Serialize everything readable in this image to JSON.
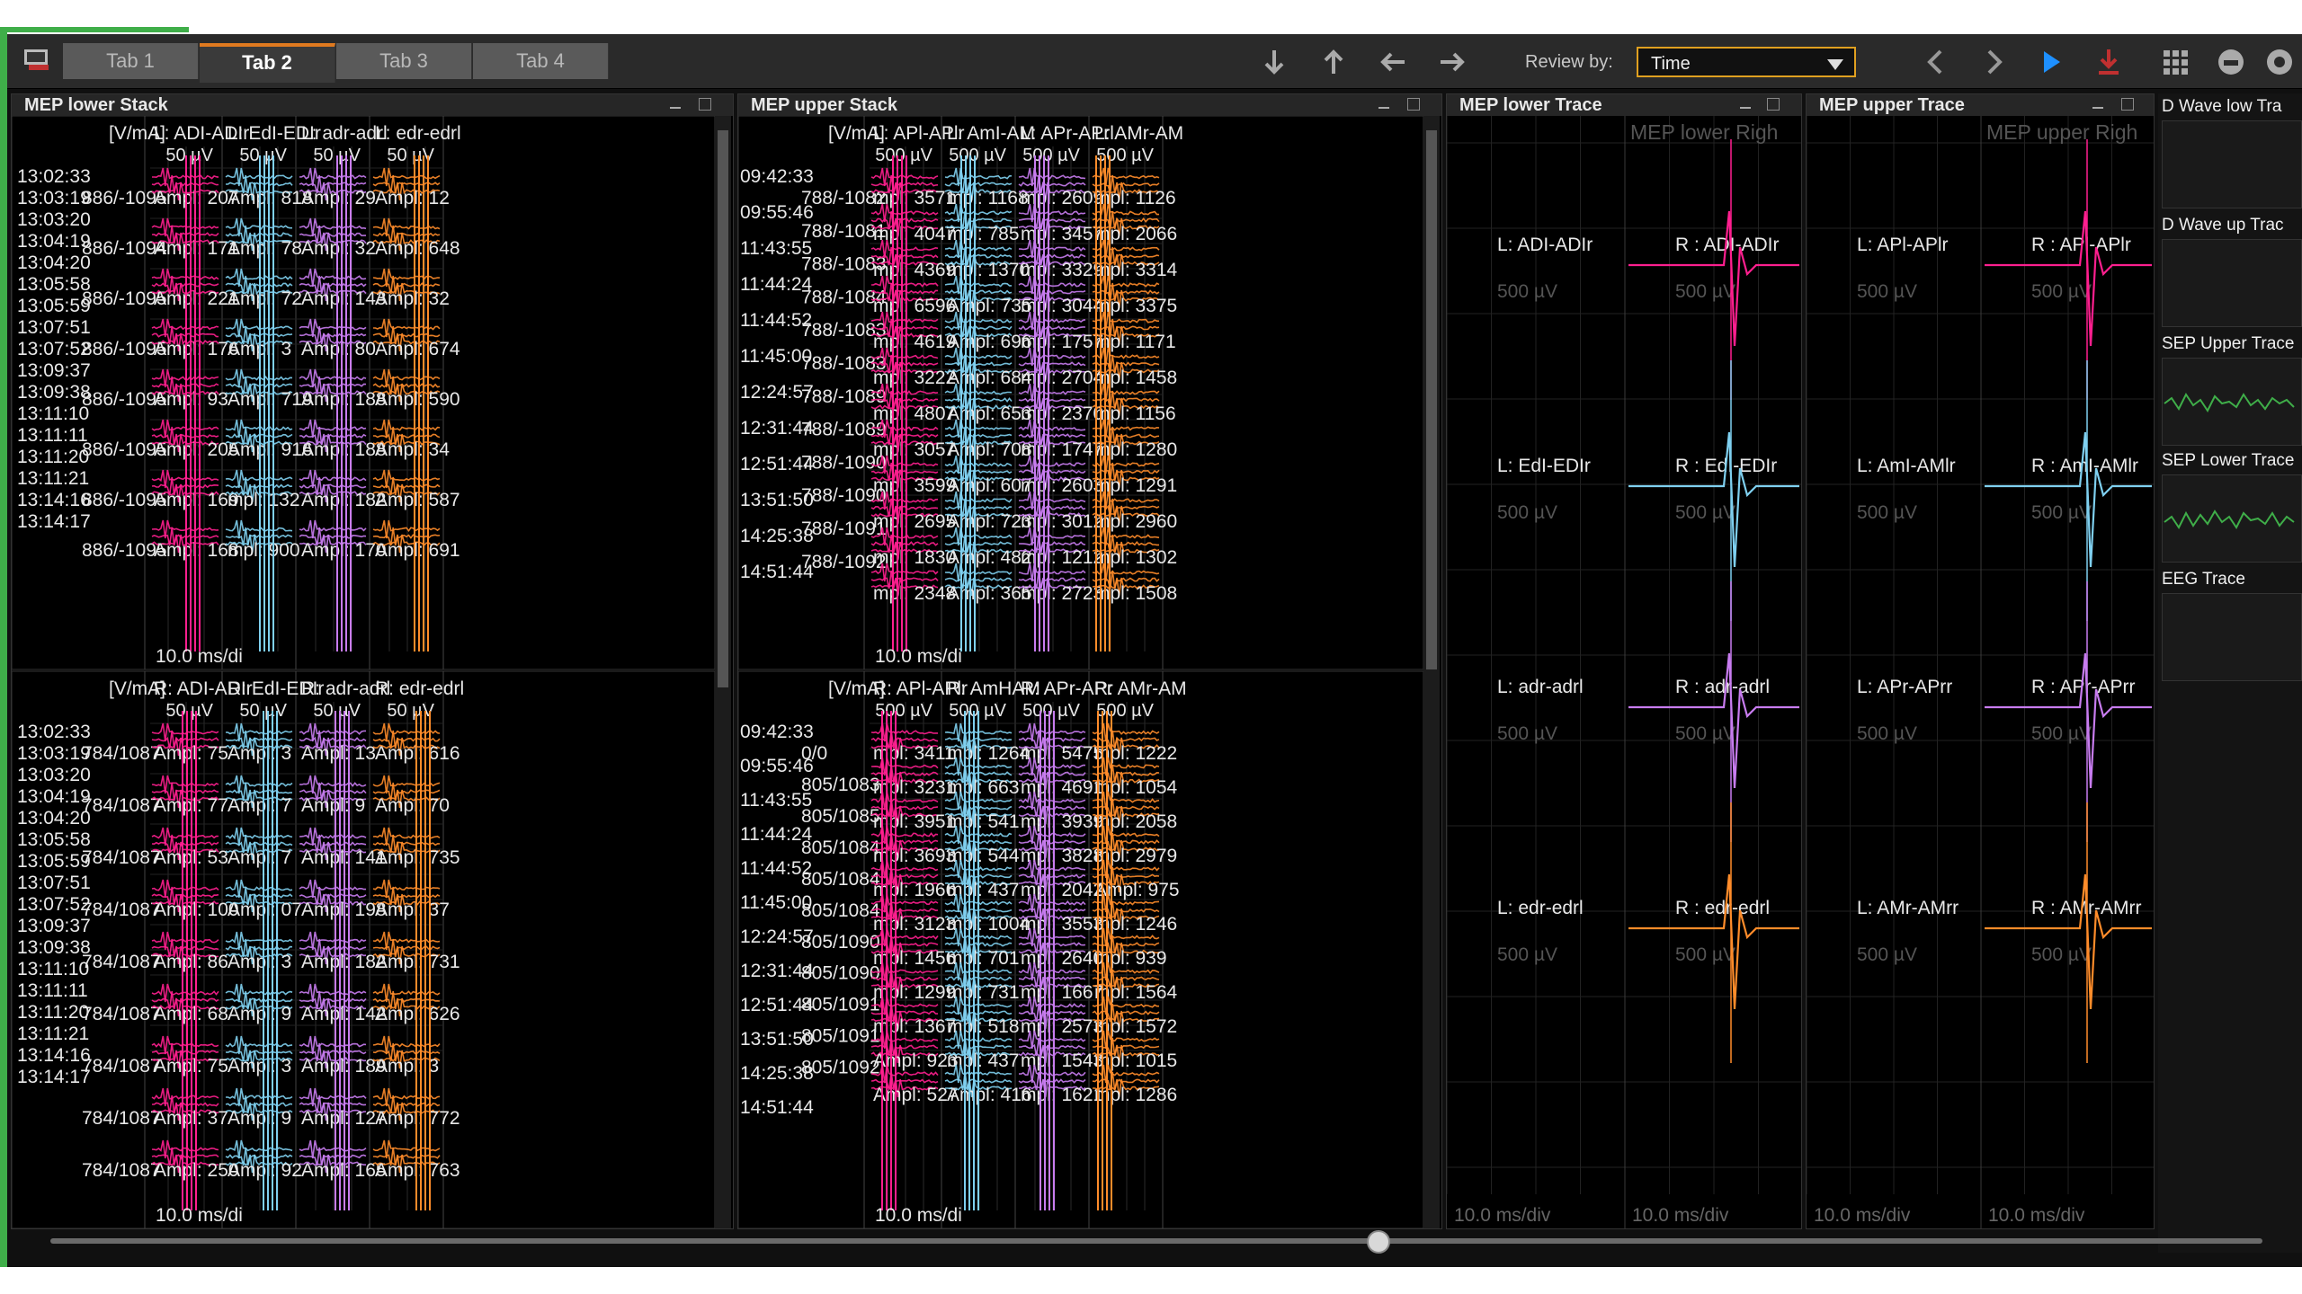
{
  "toolbar": {
    "tabs": [
      "Tab 1",
      "Tab 2",
      "Tab 3",
      "Tab 4"
    ],
    "active_tab": "Tab 2",
    "review_label": "Review by:",
    "review_value": "Time"
  },
  "panels": {
    "lower_stack_title": "MEP lower Stack",
    "upper_stack_title": "MEP upper Stack",
    "lower_trace_title": "MEP lower Trace",
    "upper_trace_title": "MEP upper Trace"
  },
  "lower_stack": {
    "top": {
      "unit": "[V/mA]",
      "channels": [
        "L: ADI-ADIr",
        "L: EdI-EDIr",
        "L: adr-adrl",
        "L: edr-edrl"
      ],
      "scales": [
        "50 µV",
        "50 µV",
        "50 µV",
        "50 µV"
      ],
      "times": [
        "13:02:33",
        "13:03:19",
        "13:03:20",
        "13:04:19",
        "13:04:20",
        "13:05:58",
        "13:05:59",
        "13:07:51",
        "13:07:52",
        "13:09:37",
        "13:09:38",
        "13:11:10",
        "13:11:11",
        "13:11:20",
        "13:11:21",
        "13:14:16",
        "13:14:17"
      ],
      "stims": [
        "886/-1095",
        "886/-1094",
        "886/-1095",
        "886/-1095",
        "886/-1095",
        "886/-1095",
        "886/-1095",
        "886/-1095"
      ],
      "amps": [
        [
          "Ampl: 207",
          "Ampl: 818",
          "Ampl: 29",
          "Ampl: 12"
        ],
        [
          "Ampl: 171",
          "Ampl: 78",
          "Ampl: 32",
          "Ampl: 648"
        ],
        [
          "Ampl: 221",
          "Ampl: 72",
          "Ampl: 143",
          "Ampl: 32"
        ],
        [
          "Ampl: 176",
          "Ampl: 3",
          "Ampl: 80",
          "Ampl: 674"
        ],
        [
          "Ampl: 93",
          "Ampl: 719",
          "Ampl: 188",
          "Ampl: 590"
        ],
        [
          "Ampl: 205",
          "Ampl: 916",
          "Ampl: 188",
          "Ampl: 34"
        ],
        [
          "Ampl: 169",
          "mpl: 132",
          "Ampl: 182",
          "Ampl: 587"
        ],
        [
          "Ampl: 168",
          "mpl: 900",
          "Ampl: 170",
          "Ampl: 691"
        ]
      ],
      "timebase": "10.0 ms/di"
    },
    "bottom": {
      "unit": "[V/mA]",
      "channels": [
        "R: ADI-ADIr",
        "R: EdI-EDIr",
        "R: adr-adrl",
        "R: edr-edrl"
      ],
      "scales": [
        "50 µV",
        "50 µV",
        "50 µV",
        "50 µV"
      ],
      "times": [
        "13:02:33",
        "13:03:19",
        "13:03:20",
        "13:04:19",
        "13:04:20",
        "13:05:58",
        "13:05:59",
        "13:07:51",
        "13:07:52",
        "13:09:37",
        "13:09:38",
        "13:11:10",
        "13:11:11",
        "13:11:20",
        "13:11:21",
        "13:14:16",
        "13:14:17"
      ],
      "stims": [
        "784/1087",
        "784/1087",
        "784/1087",
        "784/1087",
        "784/1087",
        "784/1087",
        "784/1087",
        "784/1087",
        "784/1087"
      ],
      "amps": [
        [
          "Ampl: 75",
          "Ampl: 3",
          "Ampl: 13",
          "Ampl: 616"
        ],
        [
          "Ampl: 77",
          "Ampl: 7",
          "Ampl: 9",
          "Ampl: 70"
        ],
        [
          "Ampl: 53",
          "Ampl: 7",
          "Ampl: 141",
          "Ampl: 735"
        ],
        [
          "Ampl: 100",
          "Ampl: 07",
          "Ampl: 198",
          "Ampl: 37"
        ],
        [
          "Ampl: 86",
          "Ampl: 3",
          "Ampl: 182",
          "Ampl: 731"
        ],
        [
          "Ampl: 68",
          "Ampl: 9",
          "Ampl: 142",
          "Ampl: 626"
        ],
        [
          "Ampl: 75",
          "Ampl: 3",
          "Ampl: 189",
          "Ampl: 3"
        ],
        [
          "Ampl: 37",
          "Ampl: 9",
          "Ampl: 127",
          "Ampl: 772"
        ],
        [
          "Ampl: 250",
          "Ampl: 92",
          "Ampl: 165",
          "Ampl: 763"
        ]
      ],
      "timebase": "10.0 ms/di"
    }
  },
  "upper_stack": {
    "top": {
      "unit": "[V/mA]",
      "channels": [
        "L: APl-APlr",
        "L: AmI-AM",
        "L: APr-APrl",
        "L: AMr-AM"
      ],
      "scales": [
        "500 µV",
        "500 µV",
        "500 µV",
        "500 µV"
      ],
      "times": [
        "09:42:33",
        "09:55:46",
        "11:43:55",
        "11:44:24",
        "11:44:52",
        "11:45:00",
        "12:24:57",
        "12:31:44",
        "12:51:44",
        "13:51:50",
        "14:25:38",
        "14:51:44"
      ],
      "stims": [
        "788/-1082",
        "788/-1081",
        "788/-1083",
        "788/-1084",
        "788/-1083",
        "788/-1083",
        "788/-1089",
        "788/-1089",
        "788/-1090",
        "788/-1090",
        "788/-1091",
        "788/-1092"
      ],
      "amps": [
        [
          "mpl: 3571",
          "mpl: 1168",
          "mpl: 2609",
          "mpl: 1126"
        ],
        [
          "mpl: 4047",
          "mpl: 785",
          "mpl: 3457",
          "mpl: 2066"
        ],
        [
          "mpl: 4369",
          "mpl: 1370",
          "mpl: 3329",
          "mpl: 3314"
        ],
        [
          "mpl: 6596",
          "Ampl: 735",
          "mpl: 3044",
          "mpl: 3375"
        ],
        [
          "mpl: 4619",
          "Ampl: 696",
          "mpl: 1757",
          "mpl: 1171"
        ],
        [
          "mpl: 3222",
          "Ampl: 684",
          "mpl: 2704",
          "mpl: 1458"
        ],
        [
          "mpl: 4807",
          "Ampl: 653",
          "mpl: 2370",
          "mpl: 1156"
        ],
        [
          "mpl: 3057",
          "Ampl: 708",
          "mpl: 1747",
          "mpl: 1280"
        ],
        [
          "mpl: 3599",
          "Ampl: 607",
          "mpl: 2603",
          "mpl: 1291"
        ],
        [
          "mpl: 2695",
          "Ampl: 723",
          "mpl: 3012",
          "mpl: 2960"
        ],
        [
          "mpl: 1830",
          "Ampl: 482",
          "mpl: 1212",
          "mpl: 1302"
        ],
        [
          "mpl: 2348",
          "Ampl: 365",
          "mpl: 2723",
          "mpl: 1508"
        ]
      ],
      "timebase": "10.0 ms/di"
    },
    "bottom": {
      "unit": "[V/mA]",
      "channels": [
        "R: APl-APlr",
        "R: AmHAM",
        "R: APr-APr",
        "R: AMr-AM"
      ],
      "scales": [
        "500 µV",
        "500 µV",
        "500 µV",
        "500 µV"
      ],
      "times": [
        "09:42:33",
        "09:55:46",
        "11:43:55",
        "11:44:24",
        "11:44:52",
        "11:45:00",
        "12:24:57",
        "12:31:44",
        "12:51:44",
        "13:51:50",
        "14:25:38",
        "14:51:44"
      ],
      "stims": [
        "0/0",
        "805/1083",
        "805/1085",
        "805/1084",
        "805/1084",
        "805/1084",
        "805/1090",
        "805/1090",
        "805/1091",
        "805/1091",
        "805/1092"
      ],
      "amps": [
        [
          "mpl: 3411",
          "mpl: 1264",
          "mpl: 5475",
          "mpl: 1222"
        ],
        [
          "mpl: 3231",
          "mpl: 663",
          "mpl: 4691",
          "mpl: 1054"
        ],
        [
          "mpl: 3951",
          "mpl: 541",
          "mpl: 3939",
          "mpl: 2058"
        ],
        [
          "mpl: 3693",
          "mpl: 544",
          "mpl: 3828",
          "mpl: 2979"
        ],
        [
          "mpl: 1966",
          "mpl: 437",
          "mpl: 2042",
          "Ampl: 975"
        ],
        [
          "mpl: 3123",
          "mpl: 1004",
          "mpl: 3553",
          "mpl: 1246"
        ],
        [
          "mpl: 1456",
          "mpl: 701",
          "mpl: 2640",
          "mpl: 939"
        ],
        [
          "mpl: 1299",
          "mpl: 731",
          "mpl: 1667",
          "mpl: 1564"
        ],
        [
          "mpl: 1367",
          "mpl: 518",
          "mpl: 2573",
          "mpl: 1572"
        ],
        [
          "Ampl: 923",
          "mpl: 437",
          "mpl: 1543",
          "mpl: 1015"
        ],
        [
          "Ampl: 527",
          "Ampl: 416",
          "mpl: 1621",
          "mpl: 1286"
        ]
      ],
      "timebase": "10.0 ms/di"
    }
  },
  "lower_trace": {
    "header_right": "MEP lower Righ",
    "rows": [
      {
        "left": "L: ADI-ADIr",
        "right": "R : ADI-ADIr",
        "scale": "500 µV"
      },
      {
        "left": "L: EdI-EDIr",
        "right": "R : EdI-EDIr",
        "scale": "500 µV"
      },
      {
        "left": "L: adr-adrl",
        "right": "R : adr-adrl",
        "scale": "500 µV"
      },
      {
        "left": "L: edr-edrl",
        "right": "R : edr-edrl",
        "scale": "500 µV"
      }
    ],
    "timebase": "10.0 ms/div"
  },
  "upper_trace": {
    "header_right": "MEP upper Righ",
    "rows": [
      {
        "left": "L: APl-APlr",
        "right": "R : APl-APlr",
        "scale": "500 µV"
      },
      {
        "left": "L: AmI-AMlr",
        "right": "R : AmI-AMlr",
        "scale": "500 µV"
      },
      {
        "left": "L: APr-APrr",
        "right": "R : APr-APrr",
        "scale": "500 µV"
      },
      {
        "left": "L: AMr-AMrr",
        "right": "R : AMr-AMrr",
        "scale": "500 µV"
      }
    ],
    "timebase": "10.0 ms/div"
  },
  "thumbnails": [
    "D Wave low Tra",
    "D Wave up Trac",
    "SEP Upper Trace",
    "SEP Lower Trace",
    "EEG Trace"
  ],
  "colors": {
    "pink": "#ff1f8f",
    "cyan": "#7fd0f0",
    "violet": "#c87cf0",
    "orange": "#ff8c2a",
    "green": "#3fae49",
    "accent": "#e0a020"
  }
}
